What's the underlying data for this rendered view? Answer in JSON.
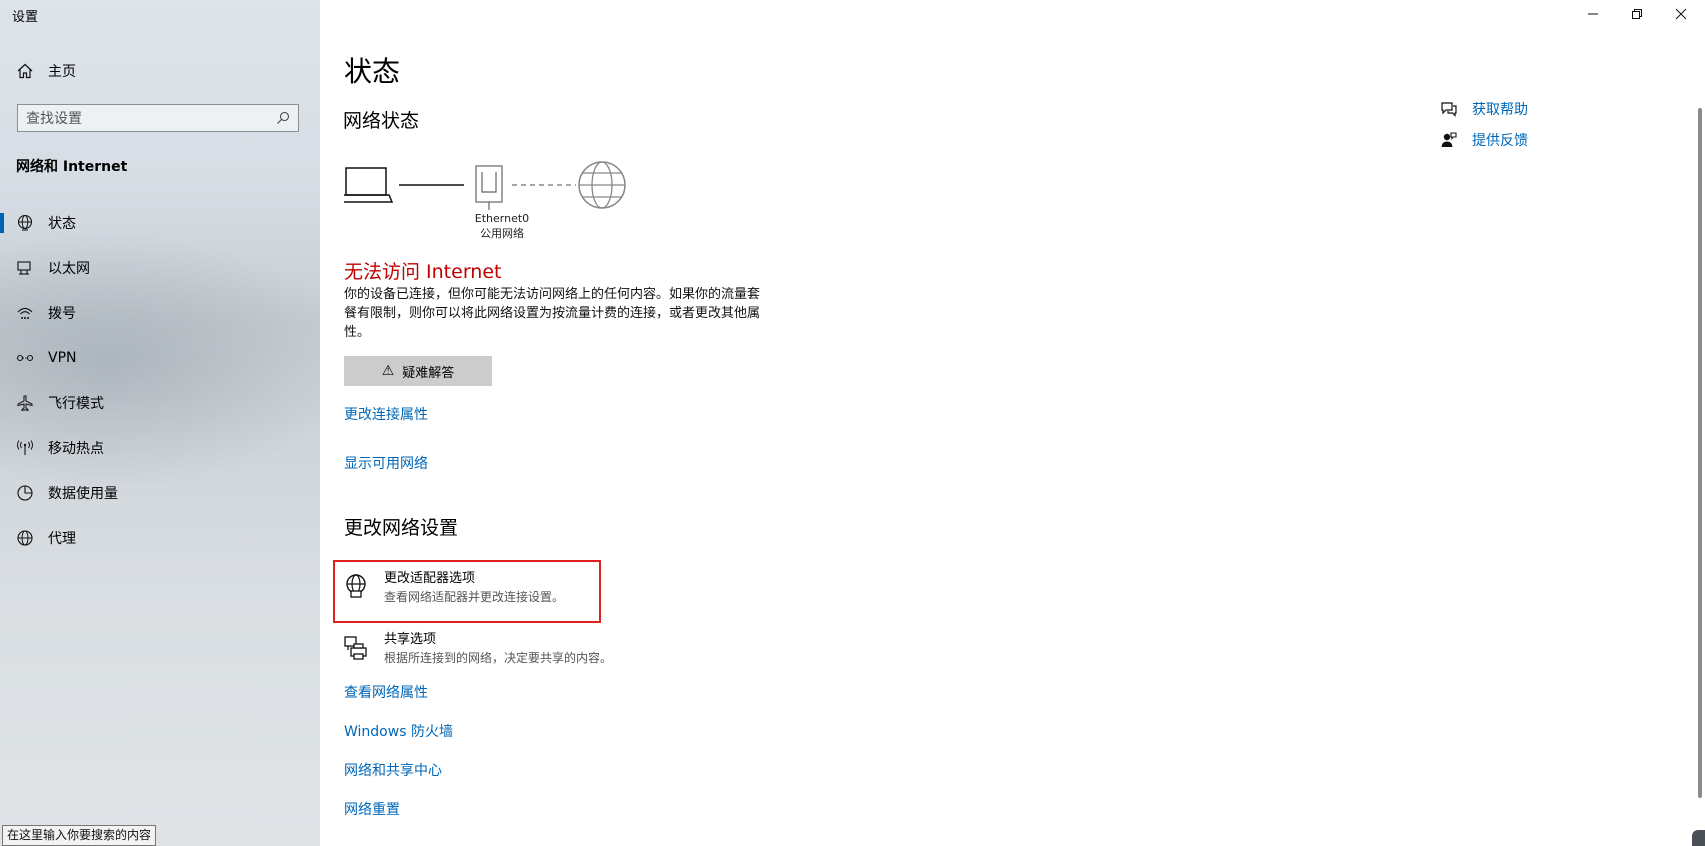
{
  "window": {
    "title": "设置",
    "controls": [
      "minimize",
      "restore",
      "close"
    ]
  },
  "sidebar": {
    "home_label": "主页",
    "search_placeholder": "查找设置",
    "section_title": "网络和 Internet",
    "items": [
      {
        "label": "状态",
        "icon": "status-globe-icon",
        "active": true
      },
      {
        "label": "以太网",
        "icon": "ethernet-icon",
        "active": false
      },
      {
        "label": "拨号",
        "icon": "dialup-icon",
        "active": false
      },
      {
        "label": "VPN",
        "icon": "vpn-icon",
        "active": false
      },
      {
        "label": "飞行模式",
        "icon": "airplane-icon",
        "active": false
      },
      {
        "label": "移动热点",
        "icon": "hotspot-icon",
        "active": false
      },
      {
        "label": "数据使用量",
        "icon": "data-usage-icon",
        "active": false
      },
      {
        "label": "代理",
        "icon": "proxy-globe-icon",
        "active": false
      }
    ],
    "tooltip": "在这里输入你要搜索的内容"
  },
  "main": {
    "page_title": "状态",
    "network_status_heading": "网络状态",
    "adapter_name": "Ethernet0",
    "network_type": "公用网络",
    "warning_title": "无法访问 Internet",
    "warning_desc": "你的设备已连接，但你可能无法访问网络上的任何内容。如果你的流量套餐有限制，则你可以将此网络设置为按流量计费的连接，或者更改其他属性。",
    "troubleshoot_label": "疑难解答",
    "link_change_props": "更改连接属性",
    "link_show_networks": "显示可用网络",
    "change_settings_heading": "更改网络设置",
    "options": [
      {
        "title": "更改适配器选项",
        "desc": "查看网络适配器并更改连接设置。",
        "icon": "adapter-globe-icon"
      },
      {
        "title": "共享选项",
        "desc": "根据所连接到的网络，决定要共享的内容。",
        "icon": "sharing-printer-icon"
      }
    ],
    "links": [
      "查看网络属性",
      "Windows 防火墙",
      "网络和共享中心",
      "网络重置"
    ]
  },
  "help": {
    "get_help": "获取帮助",
    "feedback": "提供反馈"
  },
  "colors": {
    "accent": "#0067b8",
    "active_indicator": "#0063b1",
    "warning": "#c00000",
    "highlight_box": "#e02020"
  }
}
